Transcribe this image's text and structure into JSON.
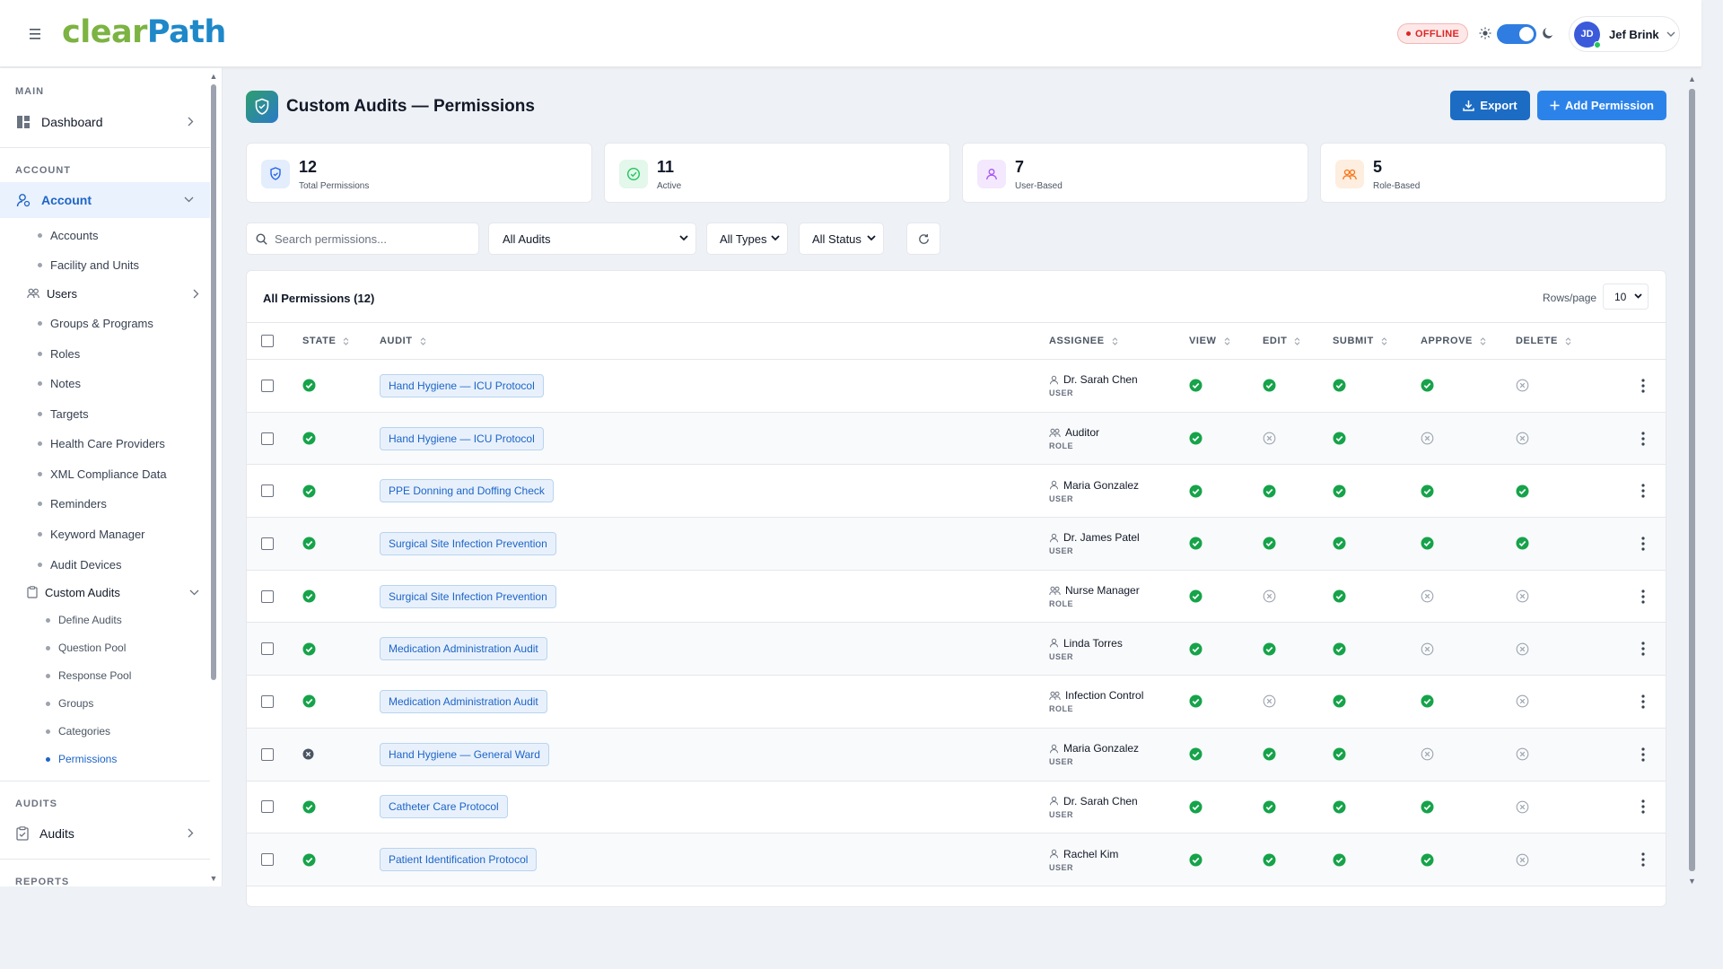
{
  "brand": {
    "part1": "clear",
    "part2": "Path",
    "primary": "#1e88c9",
    "secondary": "#7cb342"
  },
  "header": {
    "status_badge": "OFFLINE",
    "user_initials": "JD",
    "user_name": "Jef Brink",
    "dark_mode": true
  },
  "sidebar": {
    "main_label": "MAIN",
    "dashboard_label": "Dashboard",
    "account_section_label": "ACCOUNT",
    "account_label": "Account",
    "account_items": [
      "Accounts",
      "Facility and Units"
    ],
    "users_label": "Users",
    "user_items": [
      "Groups & Programs",
      "Roles",
      "Notes",
      "Targets",
      "Health Care Providers",
      "XML Compliance Data",
      "Reminders",
      "Keyword Manager",
      "Audit Devices"
    ],
    "custom_audits_label": "Custom Audits",
    "custom_audit_items": [
      "Define Audits",
      "Question Pool",
      "Response Pool",
      "Groups",
      "Categories",
      "Permissions"
    ],
    "audits_section_label": "AUDITS",
    "audits_label": "Audits",
    "reports_section_label": "REPORTS"
  },
  "page": {
    "title": "Custom Audits — Permissions",
    "export_label": "Export",
    "add_label": "Add Permission"
  },
  "stats": [
    {
      "value": "12",
      "label": "Total Permissions",
      "color": "#2563eb"
    },
    {
      "value": "11",
      "label": "Active",
      "color": "#22c55e"
    },
    {
      "value": "7",
      "label": "User-Based",
      "color": "#a855f7"
    },
    {
      "value": "5",
      "label": "Role-Based",
      "color": "#f97316"
    }
  ],
  "filters": {
    "search_placeholder": "Search permissions...",
    "audit_filter": "All Audits",
    "type_filter": "All Types",
    "status_filter": "All Status"
  },
  "table": {
    "title": "All Permissions (12)",
    "rows_per_page_label": "Rows/page",
    "rows_per_page": "10",
    "columns": {
      "state": "STATE",
      "audit": "AUDIT",
      "assignee": "ASSIGNEE",
      "view": "VIEW",
      "edit": "EDIT",
      "submit": "SUBMIT",
      "approve": "APPROVE",
      "delete": "DELETE"
    },
    "rows": [
      {
        "active": true,
        "audit": "Hand Hygiene — ICU Protocol",
        "assignee": "Dr. Sarah Chen",
        "type": "USER",
        "perms": [
          true,
          true,
          true,
          true,
          false
        ]
      },
      {
        "active": true,
        "audit": "Hand Hygiene — ICU Protocol",
        "assignee": "Auditor",
        "type": "ROLE",
        "perms": [
          true,
          false,
          true,
          false,
          false
        ]
      },
      {
        "active": true,
        "audit": "PPE Donning and Doffing Check",
        "assignee": "Maria Gonzalez",
        "type": "USER",
        "perms": [
          true,
          true,
          true,
          true,
          true
        ]
      },
      {
        "active": true,
        "audit": "Surgical Site Infection Prevention",
        "assignee": "Dr. James Patel",
        "type": "USER",
        "perms": [
          true,
          true,
          true,
          true,
          true
        ]
      },
      {
        "active": true,
        "audit": "Surgical Site Infection Prevention",
        "assignee": "Nurse Manager",
        "type": "ROLE",
        "perms": [
          true,
          false,
          true,
          false,
          false
        ]
      },
      {
        "active": true,
        "audit": "Medication Administration Audit",
        "assignee": "Linda Torres",
        "type": "USER",
        "perms": [
          true,
          true,
          true,
          false,
          false
        ]
      },
      {
        "active": true,
        "audit": "Medication Administration Audit",
        "assignee": "Infection Control",
        "type": "ROLE",
        "perms": [
          true,
          false,
          true,
          true,
          false
        ]
      },
      {
        "active": false,
        "audit": "Hand Hygiene — General Ward",
        "assignee": "Maria Gonzalez",
        "type": "USER",
        "perms": [
          true,
          true,
          true,
          false,
          false
        ]
      },
      {
        "active": true,
        "audit": "Catheter Care Protocol",
        "assignee": "Dr. Sarah Chen",
        "type": "USER",
        "perms": [
          true,
          true,
          true,
          true,
          false
        ]
      },
      {
        "active": true,
        "audit": "Patient Identification Protocol",
        "assignee": "Rachel Kim",
        "type": "USER",
        "perms": [
          true,
          true,
          true,
          true,
          false
        ]
      }
    ]
  }
}
